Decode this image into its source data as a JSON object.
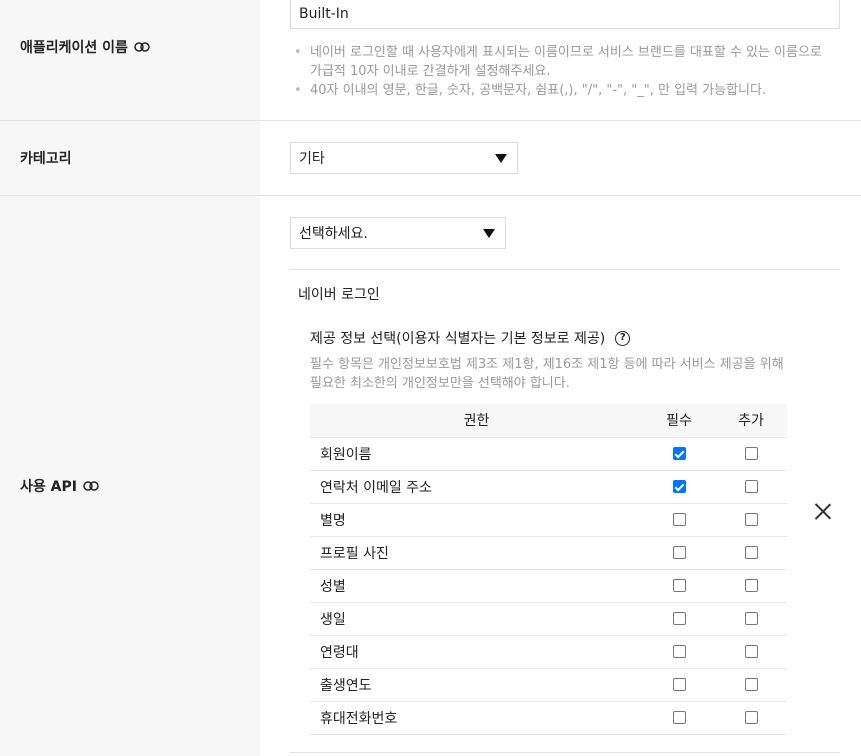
{
  "app_name": {
    "label": "애플리케이션 이름",
    "value": "Built-In",
    "help": [
      "네이버 로그인할 때 사용자에게 표시되는 이름이므로 서비스 브랜드를 대표할 수 있는 이름으로 가급적 10자 이내로 간결하게 설정해주세요.",
      "40자 이내의 영문, 한글, 숫자, 공백문자, 쉼표(,), \"/\", \"-\", \"_\", 만 입력 가능합니다."
    ]
  },
  "category": {
    "label": "카테고리",
    "selected": "기타"
  },
  "api": {
    "label": "사용 API",
    "select_placeholder": "선택하세요.",
    "section_title": "네이버 로그인",
    "info_title": "제공 정보 선택(이용자 식별자는 기본 정보로 제공)",
    "info_desc": "필수 항목은 개인정보보호법 제3조 제1항, 제16조 제1항 등에 따라 서비스 제공을 위해 필요한 최소한의 개인정보만을 선택해야 합니다.",
    "table": {
      "headers": [
        "권한",
        "필수",
        "추가"
      ],
      "rows": [
        {
          "name": "회원이름",
          "required": true,
          "extra": false
        },
        {
          "name": "연락처 이메일 주소",
          "required": true,
          "extra": false
        },
        {
          "name": "별명",
          "required": false,
          "extra": false
        },
        {
          "name": "프로필 사진",
          "required": false,
          "extra": false
        },
        {
          "name": "성별",
          "required": false,
          "extra": false
        },
        {
          "name": "생일",
          "required": false,
          "extra": false
        },
        {
          "name": "연령대",
          "required": false,
          "extra": false
        },
        {
          "name": "출생연도",
          "required": false,
          "extra": false
        },
        {
          "name": "휴대전화번호",
          "required": false,
          "extra": false
        }
      ]
    }
  },
  "icons": {
    "link": "link-icon",
    "help": "question-circle-icon",
    "remove": "close-icon",
    "dropdown": "caret-down-icon"
  },
  "colors": {
    "label_bg": "#f7f7f7",
    "checkbox_checked": "#0075ff",
    "help_text": "#999999"
  }
}
